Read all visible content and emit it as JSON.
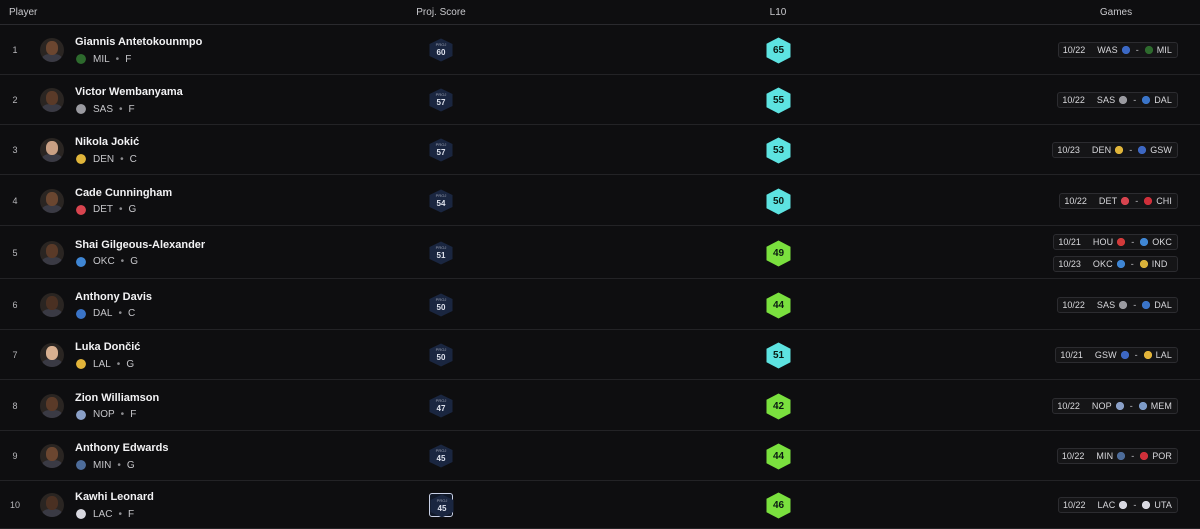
{
  "header": {
    "player": "Player",
    "proj": "Proj. Score",
    "l10": "L10",
    "games": "Games"
  },
  "colors": {
    "cyan": "#5de3e1",
    "green": "#7ae03e",
    "navy_hex": "#1a2640"
  },
  "rows": [
    {
      "rank": "1",
      "name": "Giannis Antetokounmpo",
      "team": "MIL",
      "pos": "F",
      "proj_label": "PROJ",
      "proj": "60",
      "l10": "65",
      "l10_color": "cyan",
      "games": [
        {
          "date": "10/22",
          "away": "WAS",
          "home": "MIL"
        }
      ]
    },
    {
      "rank": "2",
      "name": "Victor Wembanyama",
      "team": "SAS",
      "pos": "F",
      "proj_label": "PROJ",
      "proj": "57",
      "l10": "55",
      "l10_color": "cyan",
      "games": [
        {
          "date": "10/22",
          "away": "SAS",
          "home": "DAL"
        }
      ]
    },
    {
      "rank": "3",
      "name": "Nikola Jokić",
      "team": "DEN",
      "pos": "C",
      "proj_label": "PROJ",
      "proj": "57",
      "l10": "53",
      "l10_color": "cyan",
      "games": [
        {
          "date": "10/23",
          "away": "DEN",
          "home": "GSW"
        }
      ]
    },
    {
      "rank": "4",
      "name": "Cade Cunningham",
      "team": "DET",
      "pos": "G",
      "proj_label": "PROJ",
      "proj": "54",
      "l10": "50",
      "l10_color": "cyan",
      "games": [
        {
          "date": "10/22",
          "away": "DET",
          "home": "CHI"
        }
      ]
    },
    {
      "rank": "5",
      "name": "Shai Gilgeous-Alexander",
      "team": "OKC",
      "pos": "G",
      "proj_label": "PROJ",
      "proj": "51",
      "l10": "49",
      "l10_color": "green",
      "games": [
        {
          "date": "10/21",
          "away": "HOU",
          "home": "OKC"
        },
        {
          "date": "10/23",
          "away": "OKC",
          "home": "IND"
        }
      ]
    },
    {
      "rank": "6",
      "name": "Anthony Davis",
      "team": "DAL",
      "pos": "C",
      "proj_label": "PROJ",
      "proj": "50",
      "l10": "44",
      "l10_color": "green",
      "games": [
        {
          "date": "10/22",
          "away": "SAS",
          "home": "DAL"
        }
      ]
    },
    {
      "rank": "7",
      "name": "Luka Dončić",
      "team": "LAL",
      "pos": "G",
      "proj_label": "PROJ",
      "proj": "50",
      "l10": "51",
      "l10_color": "cyan",
      "games": [
        {
          "date": "10/21",
          "away": "GSW",
          "home": "LAL"
        }
      ]
    },
    {
      "rank": "8",
      "name": "Zion Williamson",
      "team": "NOP",
      "pos": "F",
      "proj_label": "PROJ",
      "proj": "47",
      "l10": "42",
      "l10_color": "green",
      "games": [
        {
          "date": "10/22",
          "away": "NOP",
          "home": "MEM"
        }
      ]
    },
    {
      "rank": "9",
      "name": "Anthony Edwards",
      "team": "MIN",
      "pos": "G",
      "proj_label": "PROJ",
      "proj": "45",
      "l10": "44",
      "l10_color": "green",
      "games": [
        {
          "date": "10/22",
          "away": "MIN",
          "home": "POR"
        }
      ]
    },
    {
      "rank": "10",
      "name": "Kawhi Leonard",
      "team": "LAC",
      "pos": "F",
      "proj_label": "PROJ",
      "proj": "45",
      "l10": "46",
      "l10_color": "green",
      "selected": true,
      "games": [
        {
          "date": "10/22",
          "away": "LAC",
          "home": "UTA"
        }
      ]
    }
  ],
  "team_colors": {
    "MIL": "#2d6a2d",
    "SAS": "#9a9aa0",
    "DEN": "#e0b53a",
    "DET": "#d8444f",
    "OKC": "#3f86d4",
    "DAL": "#3a74c8",
    "LAL": "#e2b43a",
    "NOP": "#8aa0c8",
    "MIN": "#4d6c9a",
    "LAC": "#d8d8e0",
    "WAS": "#3b68c4",
    "CHI": "#cf2f3a",
    "HOU": "#d23a3a",
    "IND": "#d9b23a",
    "GSW": "#3d67c2",
    "MEM": "#7d9bc8",
    "POR": "#d0303a",
    "UTA": "#d8d8e0"
  }
}
